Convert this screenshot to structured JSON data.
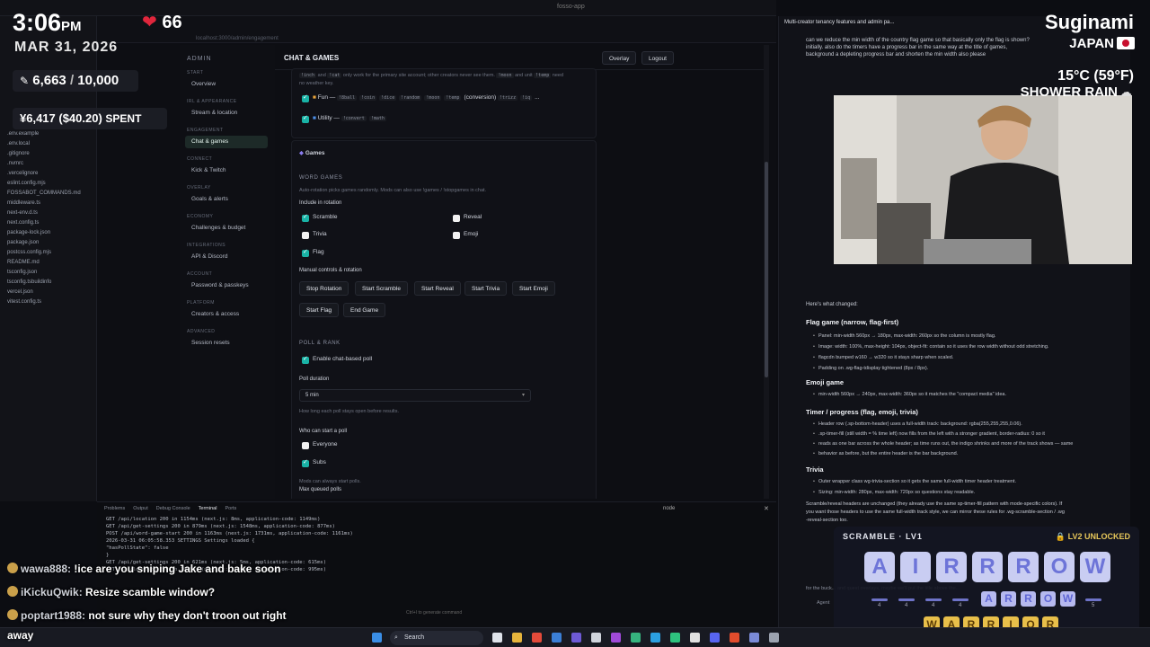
{
  "window": {
    "title": "fosso-app"
  },
  "explorer": {
    "files": [
      ".env.example",
      ".env.local",
      ".gitignore",
      ".nvmrc",
      ".vercelignore",
      "eslint.config.mjs",
      "FOSSABOT_COMMANDS.md",
      "middleware.ts",
      "next-env.d.ts",
      "next.config.ts",
      "package-lock.json",
      "package.json",
      "postcss.config.mjs",
      "README.md",
      "tsconfig.json",
      "tsconfig.tsbuildinfo",
      "vercel.json",
      "vitest.config.ts"
    ]
  },
  "browser": {
    "url": "localhost:3000/admin/engagement"
  },
  "admin_sidebar": {
    "brand": "ADMIN",
    "sections": [
      {
        "title": "START",
        "items": [
          "Overview"
        ]
      },
      {
        "title": "IRL & APPEARANCE",
        "items": [
          "Stream & location"
        ]
      },
      {
        "title": "ENGAGEMENT",
        "items": [
          "Chat & games"
        ]
      },
      {
        "title": "CONNECT",
        "items": [
          "Kick & Twitch"
        ]
      },
      {
        "title": "OVERLAY",
        "items": [
          "Goals & alerts"
        ]
      },
      {
        "title": "ECONOMY",
        "items": [
          "Challenges & budget"
        ]
      },
      {
        "title": "INTEGRATIONS",
        "items": [
          "API & Discord"
        ]
      },
      {
        "title": "ACCOUNT",
        "items": [
          "Password & passkeys"
        ]
      },
      {
        "title": "PLATFORM",
        "items": [
          "Creators & access"
        ]
      },
      {
        "title": "ADVANCED",
        "items": [
          "Session resets"
        ]
      }
    ]
  },
  "main": {
    "title": "CHAT & GAMES",
    "overlay_btn": "Overlay",
    "logout_btn": "Logout",
    "note_a": "!inch",
    "note_b": "and",
    "note_c": "!cat",
    "note_d": "only work for the primary site account; other creators never see them.",
    "note_e": "!moon",
    "note_f": "and unit",
    "note_g": "!temp",
    "note_h": "need",
    "note_i": "no weather key.",
    "fun_label": "Fun —",
    "fun_codes": [
      "!8ball",
      "!coin",
      "!dice",
      "!random",
      "!moon",
      "!temp"
    ],
    "fun_conv": "(conversion)",
    "fun_more": [
      "!trizz",
      "!iq"
    ],
    "fun_ellipsis": "...",
    "utility_label": "Utility —",
    "utility_codes": [
      "!convert",
      "!math"
    ],
    "games_title": "Games",
    "word_games": "WORD GAMES",
    "word_games_help": "Auto-rotation picks games randomly. Mods can also use !games / !stopgames in chat.",
    "include_label": "Include in rotation",
    "games": [
      {
        "name": "Scramble",
        "checked": true
      },
      {
        "name": "Reveal",
        "checked": false
      },
      {
        "name": "Trivia",
        "checked": false
      },
      {
        "name": "Emoji",
        "checked": false
      },
      {
        "name": "Flag",
        "checked": true
      }
    ],
    "manual_label": "Manual controls & rotation",
    "controls": [
      "Stop Rotation",
      "Start Scramble",
      "Start Reveal",
      "Start Trivia",
      "Start Emoji",
      "Start Flag",
      "End Game"
    ],
    "poll_head": "POLL & RANK",
    "enable_poll": "Enable chat-based poll",
    "poll_duration_label": "Poll duration",
    "poll_duration_value": "5 min",
    "poll_duration_help": "How long each poll stays open before results.",
    "who_label": "Who can start a poll",
    "who_options": [
      {
        "name": "Everyone",
        "checked": false
      },
      {
        "name": "Subs",
        "checked": true
      }
    ],
    "mods_note": "Mods can always start polls.",
    "max_queued": "Max queued polls"
  },
  "terminal": {
    "tabs": [
      "Problems",
      "Output",
      "Debug Console",
      "Terminal",
      "Ports"
    ],
    "active_tab": "Terminal",
    "shell": "node",
    "lines": [
      "GET /api/location 200 in 1154ms (next.js: 8ms, application-code: 1149ms)",
      "GET /api/get-settings 200 in 879ms (next.js: 1548ms, application-code: 877ms)",
      "POST /api/word-game-start 200 in 1163ms (next.js: 1731ms, application-code: 1161ms)",
      "2026-03-31 06:05:58.353 SETTINGS Settings loaded {",
      "  \"hasPollState\": false",
      "}",
      "GET /api/get-settings 200 in 621ms (next.js: 5ms, application-code: 615ms)",
      "GET /api/location 200 in 1000ms (next.js: 1440ms, application-code: 995ms)"
    ],
    "hint": "Ctrl+I to generate command"
  },
  "chat": [
    {
      "user": "wawa888:",
      "msg": "!ice are you sniping Jake and bake soon"
    },
    {
      "user": "iKickuQwik:",
      "msg": "Resize scamble window?"
    },
    {
      "user": "poptart1988:",
      "msg": "not sure why they don't troon out right"
    }
  ],
  "stream": {
    "time": "3:06",
    "ampm": "PM",
    "date": "MAR 31, 2026",
    "hearts": "66",
    "sub_current": "6,663",
    "sub_sep": "/",
    "sub_goal": "10,000",
    "spent": "¥6,417 ($40.20)",
    "spent_label": "SPENT",
    "location_name": "Suginami",
    "country": "JAPAN",
    "temp": "15°C (59°F)",
    "weather": "SHOWER RAIN",
    "away": "away"
  },
  "assistant": {
    "tab_title": "Multi-creator tenancy features and admin pa...",
    "prompt": "can we reduce the min width of the country flag game so that basically only the flag is shown?",
    "prompt2": "initially. also do the timers have a progress bar in the same way at the title of games,",
    "prompt3": "background a depleting progress bar and shorten the min width also please",
    "changed": "Here's what changed:",
    "h_flag": "Flag game (narrow, flag-first)",
    "flag_bullets": [
      "Panel: min-width 560px → 180px, max-width: 260px so the column is mostly flag.",
      "Image: width: 100%, max-height: 104px, object-fit: contain so it uses the row width without odd stretching.",
      "flagcdn bumped w160 → w320 so it stays sharp when scaled.",
      "Padding on .wg-flag-tdisplay tightened (8px / 8px)."
    ],
    "h_emoji": "Emoji game",
    "emoji_bullets": [
      "min-width 560px → 240px, max-width: 360px so it matches the \"compact media\" idea."
    ],
    "h_timer": "Timer / progress (flag, emoji, trivia)",
    "timer_bullets": [
      "Header row (.sp-bottom-header) uses a full-width track: background: rgba(255,255,255,0.06).",
      ".sp-timer-fill (still width = % time left) now fills from the left with a stronger gradient, border-radius: 0 so it",
      "reads as one bar across the whole header; as time runs out, the indigo shrinks and more of the track shows — same",
      "behavior as before, but the entire header is the bar background."
    ],
    "h_trivia": "Trivia",
    "trivia_bullets": [
      "Outer wrapper class wg-trivia-section so it gets the same full-width timer header treatment.",
      "Sizing: min-width: 280px, max-width: 720px so questions stay readable."
    ],
    "tail1": "Scramble/reveal headers are unchanged (they already use the same sp-timer-fill pattern with mode-specific colors). If",
    "tail2": "you want those headers to use the same full-width track style, we can mirror these rules for .wg-scramble-section / .wg",
    "tail3": "-reveal-section too.",
    "input_hint": "for the buck... and quest overlays, maybe we'll put the title above the...",
    "agent": "Agent"
  },
  "scramble": {
    "title": "SCRAMBLE · LV1",
    "badge": "LV2 UNLOCKED",
    "letters": [
      "A",
      "I",
      "R",
      "R",
      "R",
      "O",
      "W"
    ],
    "arrow": [
      "A",
      "R",
      "R",
      "O",
      "W"
    ],
    "slot_nums": [
      "4",
      "4",
      "4",
      "4",
      "5"
    ],
    "warrior": [
      "W",
      "A",
      "R",
      "R",
      "I",
      "O",
      "R"
    ]
  },
  "taskbar": {
    "search": "Search"
  },
  "colors": {
    "accent": "#19b3a6",
    "heart": "#e0263c",
    "tile": "#c9cdf2",
    "gold": "#e8bf4a"
  }
}
